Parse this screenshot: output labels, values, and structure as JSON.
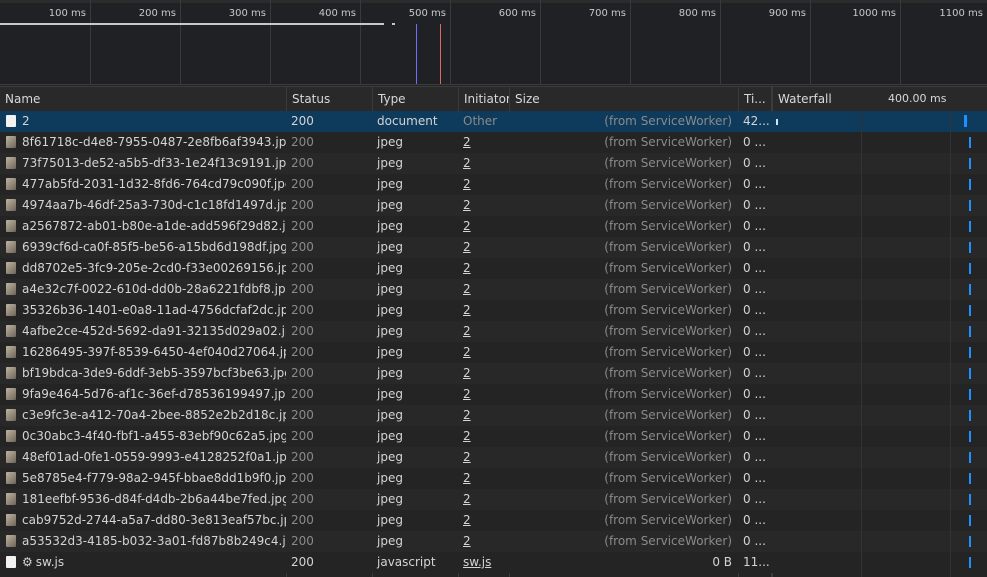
{
  "overview": {
    "ticks": [
      "100 ms",
      "200 ms",
      "300 ms",
      "400 ms",
      "500 ms",
      "600 ms",
      "700 ms",
      "800 ms",
      "900 ms",
      "1000 ms",
      "1100 ms"
    ]
  },
  "columns": {
    "name": "Name",
    "status": "Status",
    "type": "Type",
    "initiator": "Initiator",
    "size": "Size",
    "time": "Ti...",
    "waterfall": "Waterfall",
    "waterfall_marker": "400.00 ms"
  },
  "colors": {
    "selected_row": "#0e3a5c",
    "waterfall_bar": "#1e90ff",
    "dom_content_loaded_line": "#6f6fff",
    "load_line": "#e06666"
  },
  "rows": [
    {
      "name": "2",
      "status": "200",
      "type": "document",
      "initiator": "Other",
      "size": "(from ServiceWorker)",
      "time": "42...",
      "icon": "document-icon",
      "selected": true
    },
    {
      "name": "8f61718c-d4e8-7955-0487-2e8fb6af3943.jpg",
      "status": "200",
      "type": "jpeg",
      "initiator": "2",
      "size": "(from ServiceWorker)",
      "time": "0 ...",
      "icon": "image-icon"
    },
    {
      "name": "73f75013-de52-a5b5-df33-1e24f13c9191.jpg",
      "status": "200",
      "type": "jpeg",
      "initiator": "2",
      "size": "(from ServiceWorker)",
      "time": "0 ...",
      "icon": "image-icon"
    },
    {
      "name": "477ab5fd-2031-1d32-8fd6-764cd79c090f.jpg",
      "status": "200",
      "type": "jpeg",
      "initiator": "2",
      "size": "(from ServiceWorker)",
      "time": "0 ...",
      "icon": "image-icon"
    },
    {
      "name": "4974aa7b-46df-25a3-730d-c1c18fd1497d.jpg",
      "status": "200",
      "type": "jpeg",
      "initiator": "2",
      "size": "(from ServiceWorker)",
      "time": "0 ...",
      "icon": "image-icon"
    },
    {
      "name": "a2567872-ab01-b80e-a1de-add596f29d82.jpg",
      "status": "200",
      "type": "jpeg",
      "initiator": "2",
      "size": "(from ServiceWorker)",
      "time": "0 ...",
      "icon": "image-icon"
    },
    {
      "name": "6939cf6d-ca0f-85f5-be56-a15bd6d198df.jpg",
      "status": "200",
      "type": "jpeg",
      "initiator": "2",
      "size": "(from ServiceWorker)",
      "time": "0 ...",
      "icon": "image-icon"
    },
    {
      "name": "dd8702e5-3fc9-205e-2cd0-f33e00269156.jpg",
      "status": "200",
      "type": "jpeg",
      "initiator": "2",
      "size": "(from ServiceWorker)",
      "time": "0 ...",
      "icon": "image-icon"
    },
    {
      "name": "a4e32c7f-0022-610d-dd0b-28a6221fdbf8.jpg",
      "status": "200",
      "type": "jpeg",
      "initiator": "2",
      "size": "(from ServiceWorker)",
      "time": "0 ...",
      "icon": "image-icon"
    },
    {
      "name": "35326b36-1401-e0a8-11ad-4756dcfaf2dc.jpg",
      "status": "200",
      "type": "jpeg",
      "initiator": "2",
      "size": "(from ServiceWorker)",
      "time": "0 ...",
      "icon": "image-icon"
    },
    {
      "name": "4afbe2ce-452d-5692-da91-32135d029a02.jpg",
      "status": "200",
      "type": "jpeg",
      "initiator": "2",
      "size": "(from ServiceWorker)",
      "time": "0 ...",
      "icon": "image-icon"
    },
    {
      "name": "16286495-397f-8539-6450-4ef040d27064.jpg",
      "status": "200",
      "type": "jpeg",
      "initiator": "2",
      "size": "(from ServiceWorker)",
      "time": "0 ...",
      "icon": "image-icon"
    },
    {
      "name": "bf19bdca-3de9-6ddf-3eb5-3597bcf3be63.jpg",
      "status": "200",
      "type": "jpeg",
      "initiator": "2",
      "size": "(from ServiceWorker)",
      "time": "0 ...",
      "icon": "image-icon"
    },
    {
      "name": "9fa9e464-5d76-af1c-36ef-d78536199497.jpg",
      "status": "200",
      "type": "jpeg",
      "initiator": "2",
      "size": "(from ServiceWorker)",
      "time": "0 ...",
      "icon": "image-icon"
    },
    {
      "name": "c3e9fc3e-a412-70a4-2bee-8852e2b2d18c.jpg",
      "status": "200",
      "type": "jpeg",
      "initiator": "2",
      "size": "(from ServiceWorker)",
      "time": "0 ...",
      "icon": "image-icon"
    },
    {
      "name": "0c30abc3-4f40-fbf1-a455-83ebf90c62a5.jpg",
      "status": "200",
      "type": "jpeg",
      "initiator": "2",
      "size": "(from ServiceWorker)",
      "time": "0 ...",
      "icon": "image-icon"
    },
    {
      "name": "48ef01ad-0fe1-0559-9993-e4128252f0a1.jpg",
      "status": "200",
      "type": "jpeg",
      "initiator": "2",
      "size": "(from ServiceWorker)",
      "time": "0 ...",
      "icon": "image-icon"
    },
    {
      "name": "5e8785e4-f779-98a2-945f-bbae8dd1b9f0.jpg",
      "status": "200",
      "type": "jpeg",
      "initiator": "2",
      "size": "(from ServiceWorker)",
      "time": "0 ...",
      "icon": "image-icon"
    },
    {
      "name": "181eefbf-9536-d84f-d4db-2b6a44be7fed.jpg",
      "status": "200",
      "type": "jpeg",
      "initiator": "2",
      "size": "(from ServiceWorker)",
      "time": "0 ...",
      "icon": "image-icon"
    },
    {
      "name": "cab9752d-2744-a5a7-dd80-3e813eaf57bc.jpg",
      "status": "200",
      "type": "jpeg",
      "initiator": "2",
      "size": "(from ServiceWorker)",
      "time": "0 ...",
      "icon": "image-icon"
    },
    {
      "name": "a53532d3-4185-b032-3a01-fd87b8b249c4.jpg",
      "status": "200",
      "type": "jpeg",
      "initiator": "2",
      "size": "(from ServiceWorker)",
      "time": "0 ...",
      "icon": "image-icon"
    },
    {
      "name": "sw.js",
      "status": "200",
      "type": "javascript",
      "initiator": "sw.js",
      "size": "0 B",
      "time": "11...",
      "icon": "script-icon",
      "gear": "⚙"
    }
  ]
}
